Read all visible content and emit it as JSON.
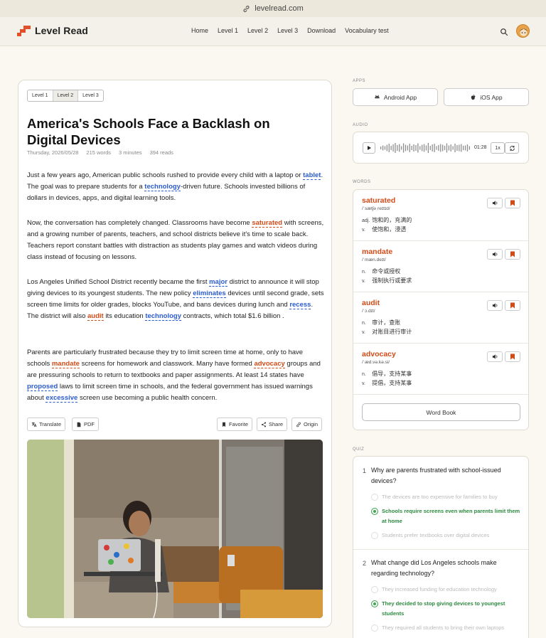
{
  "url": "levelread.com",
  "brand": "Level Read",
  "nav": [
    "Home",
    "Level 1",
    "Level 2",
    "Level 3",
    "Download",
    "Vocabulary test"
  ],
  "levels": [
    "Level 1",
    "Level 2",
    "Level 3"
  ],
  "active_level": "Level 2",
  "article": {
    "title": "America's Schools Face a Backlash on Digital Devices",
    "date": "Thursday, 2026/05/28",
    "words": "215 words",
    "minutes": "3 minutes",
    "reads": "394 reads",
    "paragraphs": [
      [
        [
          "Just a few years ago, American public schools rushed to provide every child with a laptop or "
        ],
        [
          "tablet",
          "blue"
        ],
        [
          ". The goal was to prepare students for a "
        ],
        [
          "technology",
          "blue"
        ],
        [
          "-driven future. Schools invested billions of dollars in devices, apps, and digital learning tools."
        ]
      ],
      [
        [
          "Now, the conversation has completely changed. Classrooms have become "
        ],
        [
          "saturated",
          "red"
        ],
        [
          " with screens, and a growing number of parents, teachers, and school districts believe it's time to scale back. Teachers report constant battles with distraction as students play games and watch videos during class instead of focusing on lessons."
        ]
      ],
      [
        [
          "Los Angeles Unified School District recently became the first "
        ],
        [
          "major",
          "blue"
        ],
        [
          " district to announce it will stop giving devices to its youngest students. The new policy "
        ],
        [
          "eliminates",
          "blue"
        ],
        [
          " devices until second grade, sets screen time limits for older grades, blocks YouTube, and bans devices during lunch and "
        ],
        [
          "recess",
          "blue"
        ],
        [
          ". The district will also "
        ],
        [
          "audit",
          "red"
        ],
        [
          " its education "
        ],
        [
          "technology",
          "blue"
        ],
        [
          " contracts, which total $1.6 billion ."
        ]
      ],
      [
        [
          "Parents are particularly frustrated because they try to limit screen time at home, only to have schools "
        ],
        [
          "mandate",
          "red"
        ],
        [
          " screens for homework and classwork. Many have formed "
        ],
        [
          "advocacy",
          "red"
        ],
        [
          " groups and are pressuring schools to return to textbooks and paper assignments. At least 14 states have "
        ],
        [
          "proposed",
          "blue"
        ],
        [
          " laws to limit screen time in schools, and the federal government has issued warnings about "
        ],
        [
          "excessive",
          "blue"
        ],
        [
          " screen use becoming a public health concern."
        ]
      ]
    ]
  },
  "actions": {
    "translate": "Translate",
    "pdf": "PDF",
    "favorite": "Favorite",
    "share": "Share",
    "origin": "Origin"
  },
  "sidebar": {
    "apps_label": "APPS",
    "android": "Android App",
    "ios": "iOS App",
    "audio_label": "AUDIO",
    "audio_time": "01:28",
    "audio_speed": "1x",
    "words_label": "WORDS",
    "words": [
      {
        "word": "saturated",
        "ipa": "/ˈsætʃəˌreɪtɪd/",
        "defs": [
          [
            "adj.",
            "饱和的，充满的"
          ],
          [
            "v.",
            "使饱和，浸透"
          ]
        ]
      },
      {
        "word": "mandate",
        "ipa": "/ˈmæn.deɪt/",
        "defs": [
          [
            "n.",
            "命令或授权"
          ],
          [
            "v.",
            "强制执行或要求"
          ]
        ]
      },
      {
        "word": "audit",
        "ipa": "/ˈɔ.dɪt/",
        "defs": [
          [
            "n.",
            "审计，查账"
          ],
          [
            "v.",
            "对账目进行审计"
          ]
        ]
      },
      {
        "word": "advocacy",
        "ipa": "/ˈæd.və.kə.si/",
        "defs": [
          [
            "n.",
            "倡导，支持某事"
          ],
          [
            "v.",
            "提倡，支持某事"
          ]
        ]
      }
    ],
    "wordbook": "Word Book",
    "quiz_label": "QUIZ",
    "quiz": [
      {
        "num": "1",
        "question": "Why are parents frustrated with school-issued devices?",
        "options": [
          "The devices are too expensive for families to buy",
          "Schools require screens even when parents limit them at home",
          "Students prefer textbooks over digital devices"
        ],
        "correct": 1
      },
      {
        "num": "2",
        "question": "What change did Los Angeles schools make regarding technology?",
        "options": [
          "They increased funding for education technology",
          "They decided to stop giving devices to youngest students",
          "They required all students to bring their own laptops"
        ],
        "correct": 1
      }
    ]
  },
  "colors": {
    "accent": "#e0502a",
    "link_blue": "#2a5bd0",
    "word_red": "#d24a16",
    "correct_green": "#2b8a3e"
  }
}
